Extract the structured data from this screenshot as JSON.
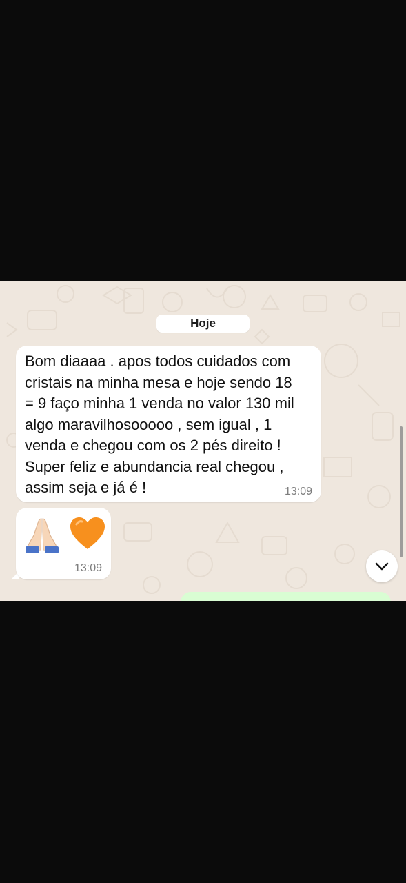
{
  "chat": {
    "date_separator": "Hoje",
    "messages": [
      {
        "direction": "incoming",
        "text": "Bom diaaaa . apos todos cuidados com\ncristais na minha mesa e hoje sendo 18\n= 9 faço minha 1 venda no valor 130 mil\nalgo maravilhosooooo , sem igual , 1\nvenda e chegou com os 2 pés direito !\nSuper feliz e abundancia real chegou ,\nassim seja e já é !",
        "time": "13:09"
      },
      {
        "direction": "incoming",
        "emojis": [
          "praying-hands",
          "orange-heart"
        ],
        "time": "13:09"
      }
    ]
  },
  "controls": {
    "scroll_down_icon": "chevron-down-icon"
  },
  "colors": {
    "chat_background": "#efe7de",
    "incoming_bubble": "#ffffff",
    "outgoing_bubble": "#d9fdd3",
    "letterbox": "#0b0b0b"
  }
}
